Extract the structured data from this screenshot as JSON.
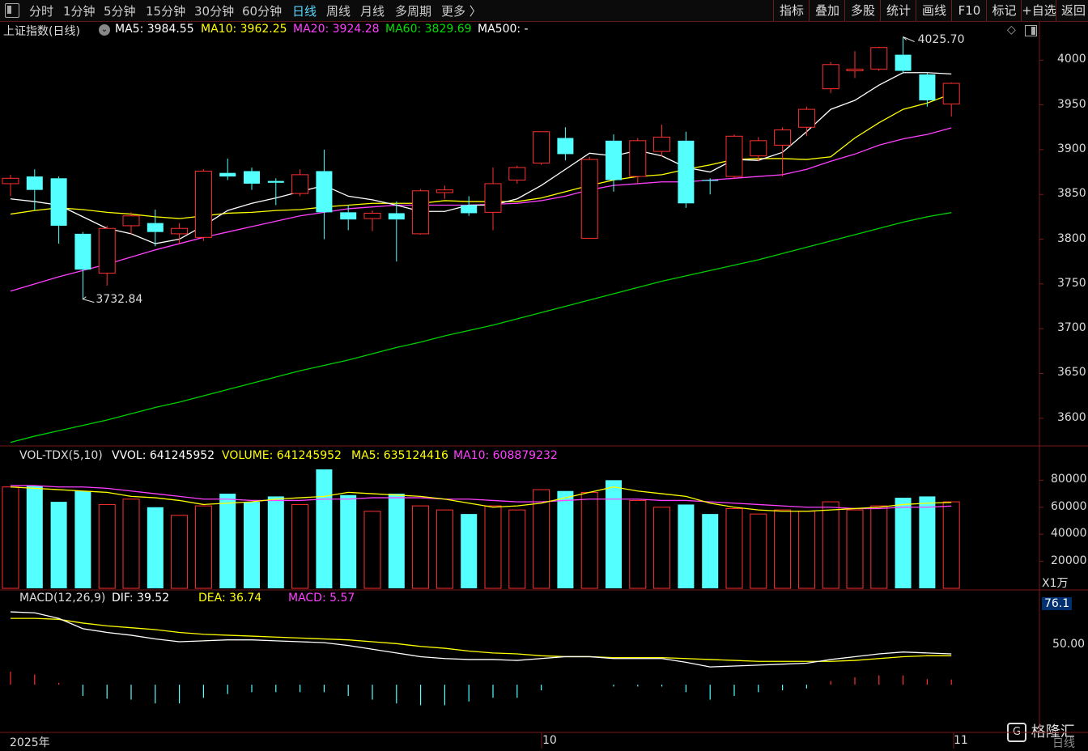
{
  "toolbar": {
    "menu_icon": "window-toggle-icon",
    "periods": [
      "分时",
      "1分钟",
      "5分钟",
      "15分钟",
      "30分钟",
      "60分钟",
      "日线",
      "周线",
      "月线",
      "多周期",
      "更多 〉"
    ],
    "active_period": "日线",
    "right_buttons": [
      "指标",
      "叠加",
      "多股",
      "统计",
      "画线",
      "F10",
      "标记",
      "+自选",
      "返回"
    ]
  },
  "main_chart": {
    "title": "上证指数(日线)",
    "ma_labels": [
      {
        "text": "MA5: 3984.55",
        "color": "#ffffff"
      },
      {
        "text": "MA10: 3962.25",
        "color": "#ffff00"
      },
      {
        "text": "MA20: 3924.28",
        "color": "#ff40ff"
      },
      {
        "text": "MA60: 3829.69",
        "color": "#00e000"
      },
      {
        "text": "MA500: -",
        "color": "#ffffff"
      }
    ],
    "high_label": "4025.70",
    "low_label": "3732.84",
    "y_ticks": [
      "4000",
      "3950",
      "3900",
      "3850",
      "3800",
      "3750",
      "3700",
      "3650",
      "3600"
    ]
  },
  "volume_panel": {
    "labels": [
      {
        "text": "VOL-TDX(5,10)",
        "color": "#dddddd"
      },
      {
        "text": "VVOL: 641245952",
        "color": "#ffffff"
      },
      {
        "text": "VOLUME: 641245952",
        "color": "#ffff00"
      },
      {
        "text": "MA5: 635124416",
        "color": "#ffff00"
      },
      {
        "text": "MA10: 608879232",
        "color": "#ff40ff"
      }
    ],
    "y_ticks": [
      "80000",
      "60000",
      "40000",
      "20000"
    ],
    "unit": "X1万"
  },
  "macd_panel": {
    "labels": [
      {
        "text": "MACD(12,26,9)",
        "color": "#dddddd"
      },
      {
        "text": "DIF: 39.52",
        "color": "#ffffff"
      },
      {
        "text": "DEA: 36.74",
        "color": "#ffff00"
      },
      {
        "text": "MACD: 5.57",
        "color": "#ff40ff"
      }
    ],
    "top_value": "76.1",
    "y_ticks": [
      "50.00"
    ]
  },
  "x_axis": {
    "labels": [
      "2025年",
      "10",
      "11"
    ],
    "right_tag": "日线"
  },
  "watermark": "格隆汇",
  "chart_data": {
    "type": "candlestick",
    "ylim": [
      3570,
      4040
    ],
    "vol_ylim": [
      0,
      88000
    ],
    "macd_ylim": [
      -45,
      85
    ],
    "candles": [
      {
        "o": 3862,
        "c": 3868,
        "h": 3872,
        "l": 3848,
        "v": 75000
      },
      {
        "o": 3870,
        "c": 3855,
        "h": 3878,
        "l": 3832,
        "v": 76000
      },
      {
        "o": 3868,
        "c": 3815,
        "h": 3870,
        "l": 3795,
        "v": 64000
      },
      {
        "o": 3806,
        "c": 3766,
        "h": 3808,
        "l": 3733,
        "v": 72000
      },
      {
        "o": 3762,
        "c": 3812,
        "h": 3815,
        "l": 3748,
        "v": 62000
      },
      {
        "o": 3815,
        "c": 3826,
        "h": 3830,
        "l": 3805,
        "v": 66000
      },
      {
        "o": 3818,
        "c": 3808,
        "h": 3833,
        "l": 3792,
        "v": 60000
      },
      {
        "o": 3806,
        "c": 3812,
        "h": 3818,
        "l": 3794,
        "v": 54000
      },
      {
        "o": 3802,
        "c": 3876,
        "h": 3878,
        "l": 3798,
        "v": 61000
      },
      {
        "o": 3874,
        "c": 3870,
        "h": 3890,
        "l": 3866,
        "v": 70000
      },
      {
        "o": 3876,
        "c": 3862,
        "h": 3880,
        "l": 3855,
        "v": 64000
      },
      {
        "o": 3865,
        "c": 3863,
        "h": 3868,
        "l": 3838,
        "v": 68000
      },
      {
        "o": 3851,
        "c": 3872,
        "h": 3878,
        "l": 3848,
        "v": 62000
      },
      {
        "o": 3876,
        "c": 3830,
        "h": 3900,
        "l": 3800,
        "v": 88000
      },
      {
        "o": 3830,
        "c": 3822,
        "h": 3838,
        "l": 3810,
        "v": 69000
      },
      {
        "o": 3823,
        "c": 3829,
        "h": 3832,
        "l": 3809,
        "v": 57000
      },
      {
        "o": 3829,
        "c": 3822,
        "h": 3842,
        "l": 3775,
        "v": 70000
      },
      {
        "o": 3806,
        "c": 3854,
        "h": 3856,
        "l": 3805,
        "v": 61000
      },
      {
        "o": 3852,
        "c": 3855,
        "h": 3860,
        "l": 3845,
        "v": 58000
      },
      {
        "o": 3838,
        "c": 3829,
        "h": 3848,
        "l": 3826,
        "v": 55000
      },
      {
        "o": 3830,
        "c": 3862,
        "h": 3880,
        "l": 3810,
        "v": 61000
      },
      {
        "o": 3866,
        "c": 3880,
        "h": 3882,
        "l": 3862,
        "v": 58000
      },
      {
        "o": 3885,
        "c": 3920,
        "h": 3920,
        "l": 3883,
        "v": 73000
      },
      {
        "o": 3913,
        "c": 3895,
        "h": 3925,
        "l": 3888,
        "v": 72000
      },
      {
        "o": 3801,
        "c": 3889,
        "h": 3892,
        "l": 3801,
        "v": 71000
      },
      {
        "o": 3910,
        "c": 3866,
        "h": 3917,
        "l": 3853,
        "v": 80000
      },
      {
        "o": 3870,
        "c": 3910,
        "h": 3913,
        "l": 3862,
        "v": 65000
      },
      {
        "o": 3898,
        "c": 3914,
        "h": 3928,
        "l": 3892,
        "v": 60000
      },
      {
        "o": 3910,
        "c": 3840,
        "h": 3920,
        "l": 3835,
        "v": 62000
      },
      {
        "o": 3866,
        "c": 3865,
        "h": 3868,
        "l": 3850,
        "v": 55000
      },
      {
        "o": 3870,
        "c": 3915,
        "h": 3917,
        "l": 3867,
        "v": 59000
      },
      {
        "o": 3893,
        "c": 3910,
        "h": 3914,
        "l": 3887,
        "v": 55000
      },
      {
        "o": 3905,
        "c": 3922,
        "h": 3925,
        "l": 3870,
        "v": 58000
      },
      {
        "o": 3925,
        "c": 3945,
        "h": 3948,
        "l": 3915,
        "v": 57000
      },
      {
        "o": 3968,
        "c": 3995,
        "h": 3998,
        "l": 3963,
        "v": 64000
      },
      {
        "o": 3988,
        "c": 3990,
        "h": 4010,
        "l": 3980,
        "v": 58000
      },
      {
        "o": 3990,
        "c": 4014,
        "h": 4015,
        "l": 3988,
        "v": 61000
      },
      {
        "o": 4006,
        "c": 3988,
        "h": 4026,
        "l": 3985,
        "v": 67000
      },
      {
        "o": 3984,
        "c": 3955,
        "h": 3986,
        "l": 3948,
        "v": 68000
      },
      {
        "o": 3951,
        "c": 3974,
        "h": 3975,
        "l": 3937,
        "v": 64000
      }
    ],
    "ma5": [
      3845,
      3842,
      3838,
      3825,
      3812,
      3806,
      3795,
      3800,
      3815,
      3832,
      3840,
      3846,
      3853,
      3860,
      3848,
      3844,
      3838,
      3831,
      3831,
      3838,
      3838,
      3845,
      3860,
      3878,
      3896,
      3893,
      3899,
      3893,
      3880,
      3875,
      3889,
      3888,
      3897,
      3920,
      3945,
      3955,
      3972,
      3986,
      3986,
      3984.55
    ],
    "ma10": [
      3828,
      3832,
      3835,
      3833,
      3830,
      3828,
      3825,
      3823,
      3826,
      3829,
      3830,
      3832,
      3833,
      3836,
      3838,
      3840,
      3840,
      3840,
      3843,
      3842,
      3842,
      3842,
      3846,
      3853,
      3860,
      3866,
      3870,
      3872,
      3878,
      3883,
      3889,
      3890,
      3890,
      3889,
      3892,
      3913,
      3930,
      3945,
      3952,
      3962.25
    ],
    "ma20": [
      3742,
      3750,
      3758,
      3765,
      3772,
      3780,
      3788,
      3795,
      3802,
      3808,
      3814,
      3820,
      3826,
      3830,
      3834,
      3836,
      3838,
      3838,
      3838,
      3838,
      3839,
      3840,
      3843,
      3848,
      3855,
      3860,
      3862,
      3864,
      3864,
      3866,
      3868,
      3870,
      3872,
      3878,
      3887,
      3895,
      3905,
      3912,
      3917,
      3924.28
    ],
    "ma60": [
      3573,
      3580,
      3586,
      3592,
      3598,
      3605,
      3612,
      3618,
      3625,
      3632,
      3639,
      3646,
      3653,
      3659,
      3665,
      3672,
      3679,
      3685,
      3692,
      3698,
      3704,
      3711,
      3718,
      3725,
      3732,
      3739,
      3746,
      3753,
      3759,
      3765,
      3771,
      3777,
      3784,
      3791,
      3798,
      3805,
      3812,
      3819,
      3825,
      3829.69
    ],
    "vol_ma5": [
      75000,
      74000,
      73000,
      72000,
      71000,
      68000,
      67000,
      65000,
      62000,
      63000,
      64000,
      66000,
      67000,
      68000,
      71000,
      70000,
      69000,
      68000,
      66000,
      63000,
      60000,
      61000,
      63000,
      67000,
      71000,
      75000,
      72000,
      70000,
      68000,
      63000,
      60000,
      58000,
      57000,
      57000,
      58000,
      59000,
      60000,
      62000,
      63000,
      63512
    ],
    "vol_ma10": [
      76000,
      76000,
      75000,
      75000,
      74000,
      72000,
      70000,
      68000,
      66000,
      66000,
      65000,
      65000,
      65000,
      66000,
      66000,
      67000,
      67000,
      67000,
      66000,
      66000,
      65000,
      64000,
      64000,
      65000,
      66000,
      66000,
      66000,
      65000,
      65000,
      64000,
      63000,
      62000,
      61000,
      60000,
      60000,
      59000,
      59000,
      60000,
      60000,
      60888
    ],
    "dif": [
      78,
      77,
      71,
      60,
      56,
      53,
      49,
      46,
      47,
      48,
      48,
      47,
      46,
      45,
      42,
      38,
      34,
      30,
      28,
      27,
      27,
      26,
      28,
      30,
      30,
      28,
      28,
      28,
      24,
      19,
      20,
      21,
      22,
      23,
      27,
      30,
      33,
      35,
      34,
      33
    ],
    "dea": [
      71,
      71,
      70,
      66,
      63,
      61,
      59,
      56,
      54,
      53,
      52,
      51,
      50,
      49,
      48,
      46,
      44,
      41,
      39,
      36,
      34,
      33,
      31,
      30,
      30,
      29,
      29,
      29,
      28,
      27,
      26,
      25,
      25,
      25,
      25,
      26,
      28,
      30,
      31,
      31
    ],
    "macd": [
      14,
      11,
      2,
      -12,
      -15,
      -16,
      -20,
      -20,
      -14,
      -10,
      -8,
      -8,
      -8,
      -8,
      -12,
      -16,
      -20,
      -22,
      -22,
      -18,
      -14,
      -14,
      -6,
      0,
      0,
      -2,
      -2,
      -2,
      -8,
      -16,
      -12,
      -8,
      -6,
      -4,
      4,
      8,
      10,
      10,
      6,
      5.57
    ]
  }
}
